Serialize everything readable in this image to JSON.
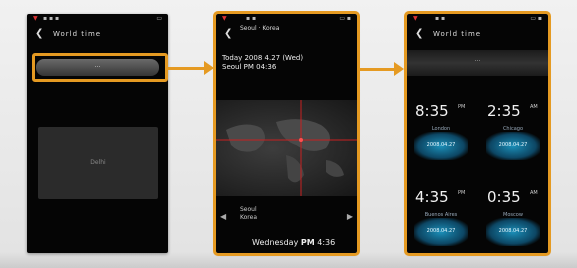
{
  "phone1": {
    "title": "World time",
    "pill": "···",
    "tile": "Delhi"
  },
  "phone2": {
    "head": "Seoul · Korea",
    "date_line": "Today 2008 4.27 (Wed)",
    "time_line": "Seoul PM 04:36",
    "city": "Seoul",
    "country": "Korea",
    "bottom_day": "Wednesday",
    "bottom_ampm": "PM",
    "bottom_time": "4:36"
  },
  "phone3": {
    "title": "World time",
    "top": "···",
    "clocks": [
      {
        "time": "8:35",
        "ap": "PM",
        "city": "London",
        "sub": "2008.04.27"
      },
      {
        "time": "2:35",
        "ap": "AM",
        "city": "Chicago",
        "sub": "2008.04.27"
      },
      {
        "time": "4:35",
        "ap": "PM",
        "city": "Buenos Aires",
        "sub": "2008.04.27"
      },
      {
        "time": "0:35",
        "ap": "AM",
        "city": "Moscow",
        "sub": "2008.04.27"
      }
    ]
  },
  "colors": {
    "accent": "#e59a22",
    "glow": "#1fa7d8"
  },
  "icons": [
    "back-arrow-icon",
    "signal-icon",
    "battery-icon",
    "left-chevron-icon",
    "right-chevron-icon"
  ]
}
